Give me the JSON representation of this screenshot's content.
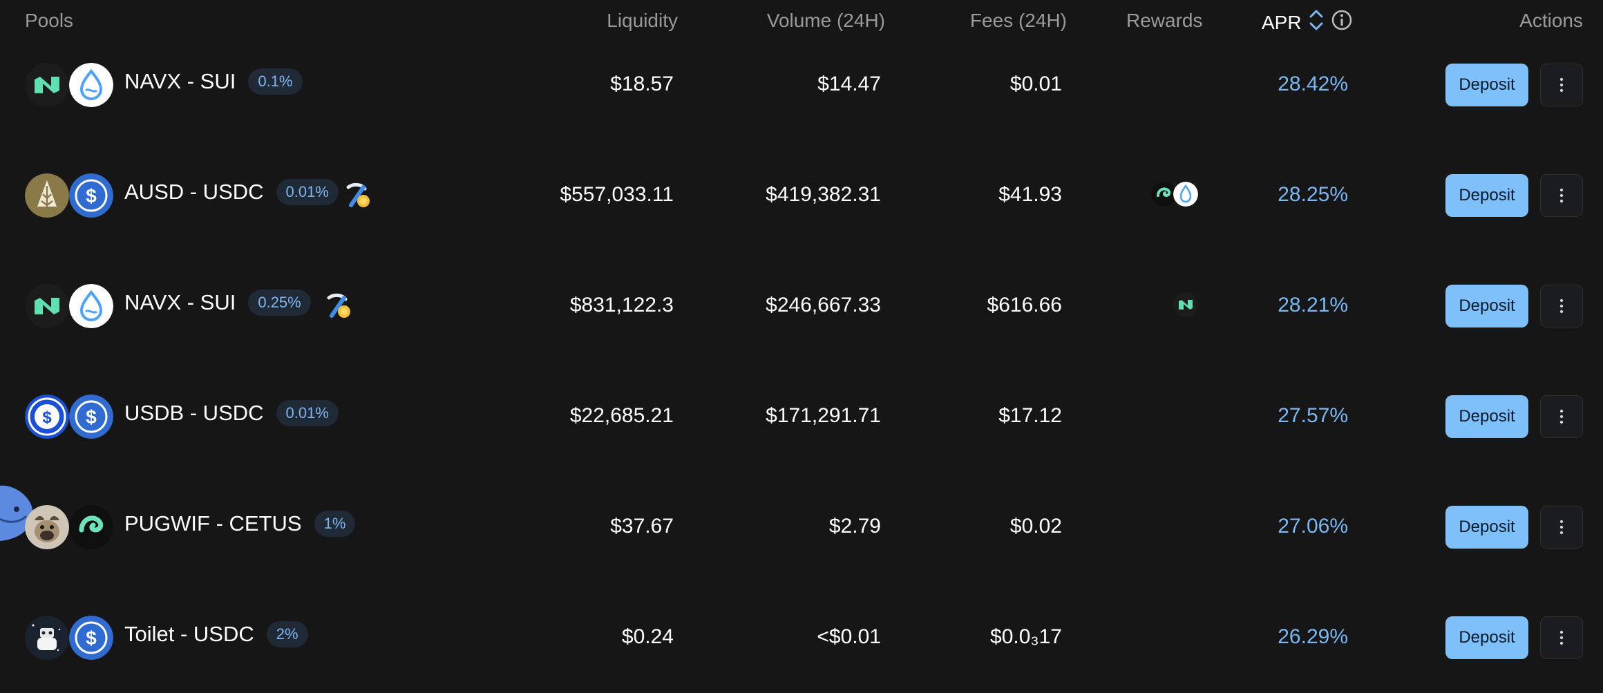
{
  "header": {
    "pools": "Pools",
    "liquidity": "Liquidity",
    "volume": "Volume (24H)",
    "fees": "Fees (24H)",
    "rewards": "Rewards",
    "apr": "APR",
    "actions": "Actions"
  },
  "colors": {
    "background": "#161616",
    "apr": "#7ab8f5",
    "deposit_button": "#7dc0fa",
    "fee_badge_bg": "#1f2a36",
    "fee_badge_text": "#7fb6ef"
  },
  "rows": [
    {
      "tokens": [
        "navx-icon",
        "sui-icon"
      ],
      "pair": "NAVX - SUI",
      "fee_tier": "0.1%",
      "mining": false,
      "liquidity": "$18.57",
      "volume": "$14.47",
      "fees": "$0.01",
      "rewards": [],
      "apr": "28.42%",
      "deposit": "Deposit"
    },
    {
      "tokens": [
        "ausd-icon",
        "usdc-icon"
      ],
      "pair": "AUSD - USDC",
      "fee_tier": "0.01%",
      "mining": true,
      "liquidity": "$557,033.11",
      "volume": "$419,382.31",
      "fees": "$41.93",
      "rewards": [
        "cetus-icon",
        "sui-icon"
      ],
      "apr": "28.25%",
      "deposit": "Deposit"
    },
    {
      "tokens": [
        "navx-icon",
        "sui-icon"
      ],
      "pair": "NAVX - SUI",
      "fee_tier": "0.25%",
      "mining": true,
      "liquidity": "$831,122.3",
      "volume": "$246,667.33",
      "fees": "$616.66",
      "rewards": [
        "navx-icon"
      ],
      "apr": "28.21%",
      "deposit": "Deposit"
    },
    {
      "tokens": [
        "usdb-icon",
        "usdc-icon"
      ],
      "pair": "USDB - USDC",
      "fee_tier": "0.01%",
      "mining": false,
      "liquidity": "$22,685.21",
      "volume": "$171,291.71",
      "fees": "$17.12",
      "rewards": [],
      "apr": "27.57%",
      "deposit": "Deposit"
    },
    {
      "tokens": [
        "pugwif-icon",
        "cetus-icon"
      ],
      "pair": "PUGWIF - CETUS",
      "fee_tier": "1%",
      "mining": false,
      "liquidity": "$37.67",
      "volume": "$2.79",
      "fees": "$0.02",
      "rewards": [],
      "apr": "27.06%",
      "deposit": "Deposit"
    },
    {
      "tokens": [
        "toilet-icon",
        "usdc-icon"
      ],
      "pair": "Toilet - USDC",
      "fee_tier": "2%",
      "mining": false,
      "liquidity": "$0.24",
      "volume": "<$0.01",
      "fees": "$0.0₃17",
      "rewards": [],
      "apr": "26.29%",
      "deposit": "Deposit"
    }
  ]
}
